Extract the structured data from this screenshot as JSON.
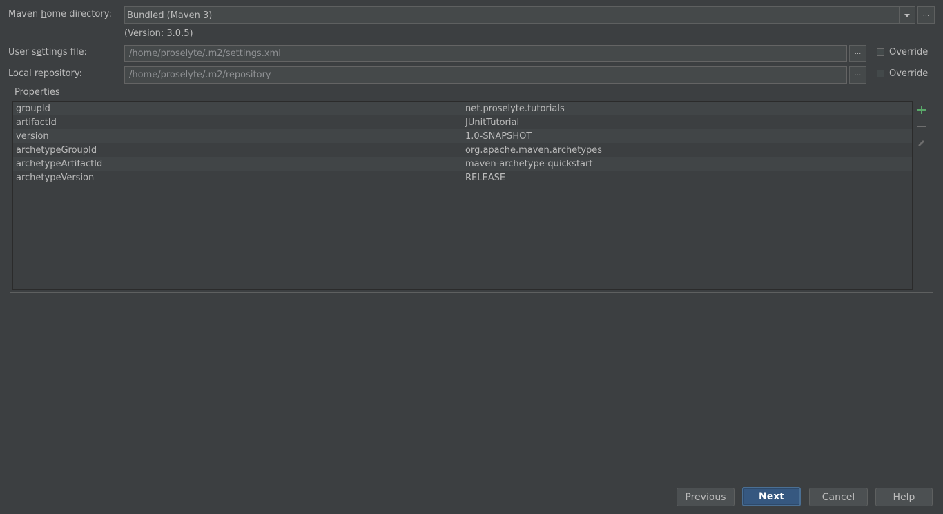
{
  "maven_home": {
    "label": "Maven home directory:",
    "value": "Bundled (Maven 3)",
    "version": "(Version: 3.0.5)"
  },
  "user_settings": {
    "label": "User settings file:",
    "value": "/home/proselyte/.m2/settings.xml",
    "override_label": "Override"
  },
  "local_repo": {
    "label": "Local repository:",
    "value": "/home/proselyte/.m2/repository",
    "override_label": "Override"
  },
  "browse_label": "...",
  "properties": {
    "title": "Properties",
    "rows": [
      {
        "key": "groupId",
        "value": "net.proselyte.tutorials"
      },
      {
        "key": "artifactId",
        "value": "JUnitTutorial"
      },
      {
        "key": "version",
        "value": "1.0-SNAPSHOT"
      },
      {
        "key": "archetypeGroupId",
        "value": "org.apache.maven.archetypes"
      },
      {
        "key": "archetypeArtifactId",
        "value": "maven-archetype-quickstart"
      },
      {
        "key": "archetypeVersion",
        "value": "RELEASE"
      }
    ],
    "tools": [
      "add-icon",
      "remove-icon",
      "edit-icon"
    ]
  },
  "buttons": {
    "previous": "Previous",
    "next": "Next",
    "cancel": "Cancel",
    "help": "Help"
  },
  "colors": {
    "background": "#3c3f41",
    "text": "#bbbbbb",
    "add_icon": "#59a869",
    "default_button": "#365880"
  }
}
